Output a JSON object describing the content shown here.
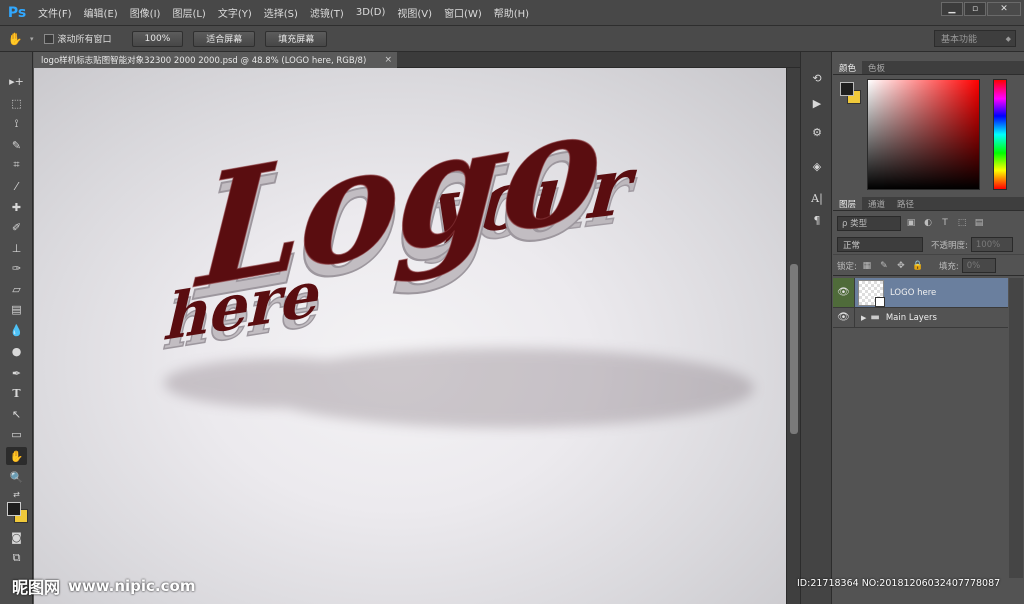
{
  "app": {
    "logo": "Ps",
    "menu": [
      "文件(F)",
      "编辑(E)",
      "图像(I)",
      "图层(L)",
      "文字(Y)",
      "选择(S)",
      "滤镜(T)",
      "3D(D)",
      "视图(V)",
      "窗口(W)",
      "帮助(H)"
    ],
    "window_controls": [
      "minimize",
      "restore",
      "close"
    ]
  },
  "options": {
    "scroll_all_label": "滚动所有窗口",
    "zoom100_label": "100%",
    "fit_screen_label": "适合屏幕",
    "fill_screen_label": "填充屏幕",
    "workspace": "基本功能"
  },
  "document": {
    "tab_title": "logo样机标志贴图智能对象32300 2000 2000.psd @ 48.8% (LOGO here, RGB/8)",
    "close": "×"
  },
  "canvas_art": {
    "word1": "your",
    "word2": "Logo",
    "word3": "here",
    "letter_color": "#5a0d10",
    "bevel_color": "#bdb8bd"
  },
  "panels": {
    "color_tabs": [
      "颜色",
      "色板"
    ],
    "fg_color": "#1e1e1e",
    "bg_color": "#f0c93a",
    "layer_tabs": [
      "图层",
      "通道",
      "路径"
    ],
    "search_kind": "ρ 类型",
    "blend_mode": "正常",
    "opacity_label": "不透明度:",
    "opacity_value": "100%",
    "lock_label": "锁定:",
    "fill_label": "填充:",
    "fill_value": "0%",
    "layers": [
      {
        "name": "LOGO here",
        "selected": true,
        "visible": true
      },
      {
        "name": "Main Layers",
        "selected": false,
        "visible": true,
        "group": true
      }
    ]
  },
  "watermark": {
    "brand": "昵图网",
    "site": "www.nipic.com",
    "id_line": "ID:21718364 NO:20181206032407778087"
  }
}
